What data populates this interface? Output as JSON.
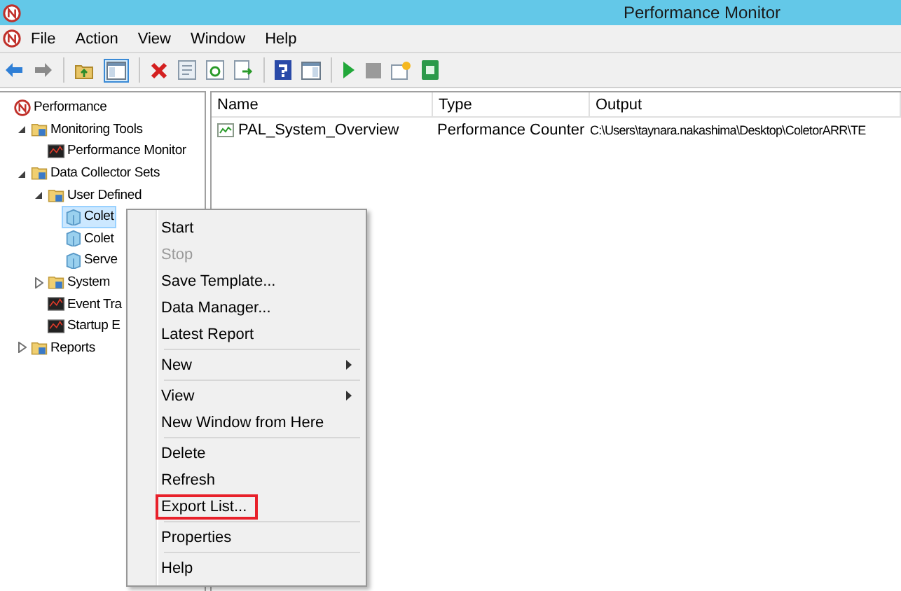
{
  "window": {
    "title": "Performance Monitor"
  },
  "menu_bar": [
    "File",
    "Action",
    "View",
    "Window",
    "Help"
  ],
  "tree": [
    {
      "label": "Performance",
      "selected": false,
      "children": [
        {
          "label": "Monitoring Tools",
          "selected": false,
          "expanded": true,
          "children": [
            {
              "label": "Performance Monitor",
              "selected": false
            }
          ]
        },
        {
          "label": "Data Collector Sets",
          "selected": false,
          "expanded": true,
          "children": [
            {
              "label": "User Defined",
              "selected": false,
              "expanded": true,
              "children": [
                {
                  "label": "Colet",
                  "selected": true
                },
                {
                  "label": "Colet",
                  "selected": false
                },
                {
                  "label": "Serve",
                  "selected": false
                }
              ]
            },
            {
              "label": "System",
              "selected": false,
              "expanded": false
            },
            {
              "label": "Event Tra",
              "selected": false
            },
            {
              "label": "Startup E",
              "selected": false
            }
          ]
        },
        {
          "label": "Reports",
          "selected": false,
          "expanded": false
        }
      ]
    }
  ],
  "table": {
    "columns": [
      "Name",
      "Type",
      "Output"
    ],
    "rows": [
      {
        "name": "PAL_System_Overview",
        "type": "Performance Counter",
        "output": "C:\\Users\\taynara.nakashima\\Desktop\\ColetorARR\\TE"
      }
    ]
  },
  "context_menu": [
    {
      "kind": "item",
      "label": "Start",
      "disabled": false,
      "submenu": false,
      "outlined": false
    },
    {
      "kind": "item",
      "label": "Stop",
      "disabled": true,
      "submenu": false,
      "outlined": false
    },
    {
      "kind": "item",
      "label": "Save Template...",
      "disabled": false,
      "submenu": false,
      "outlined": false
    },
    {
      "kind": "item",
      "label": "Data Manager...",
      "disabled": false,
      "submenu": false,
      "outlined": false
    },
    {
      "kind": "item",
      "label": "Latest Report",
      "disabled": false,
      "submenu": false,
      "outlined": false
    },
    {
      "kind": "separator"
    },
    {
      "kind": "item",
      "label": "New",
      "disabled": false,
      "submenu": true,
      "outlined": false
    },
    {
      "kind": "separator"
    },
    {
      "kind": "item",
      "label": "View",
      "disabled": false,
      "submenu": true,
      "outlined": false
    },
    {
      "kind": "item",
      "label": "New Window from Here",
      "disabled": false,
      "submenu": false,
      "outlined": false
    },
    {
      "kind": "separator"
    },
    {
      "kind": "item",
      "label": "Delete",
      "disabled": false,
      "submenu": false,
      "outlined": false
    },
    {
      "kind": "item",
      "label": "Refresh",
      "disabled": false,
      "submenu": false,
      "outlined": false
    },
    {
      "kind": "item",
      "label": "Export List...",
      "disabled": false,
      "submenu": false,
      "outlined": true
    },
    {
      "kind": "separator"
    },
    {
      "kind": "item",
      "label": "Properties",
      "disabled": false,
      "submenu": false,
      "outlined": false
    },
    {
      "kind": "separator"
    },
    {
      "kind": "item",
      "label": "Help",
      "disabled": false,
      "submenu": false,
      "outlined": false
    }
  ]
}
